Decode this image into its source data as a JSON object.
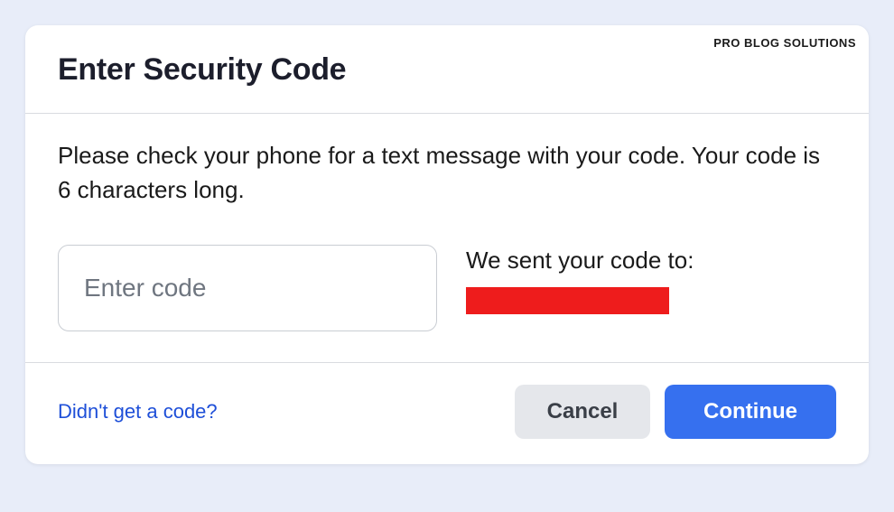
{
  "watermark": "PRO BLOG SOLUTIONS",
  "modal": {
    "title": "Enter Security Code",
    "instruction": "Please check your phone for a text message with your code. Your code is 6 characters long.",
    "code_placeholder": "Enter code",
    "sent_to_label": "We sent your code to:",
    "footer": {
      "link_text": "Didn't get a code?",
      "cancel_label": "Cancel",
      "continue_label": "Continue"
    }
  }
}
